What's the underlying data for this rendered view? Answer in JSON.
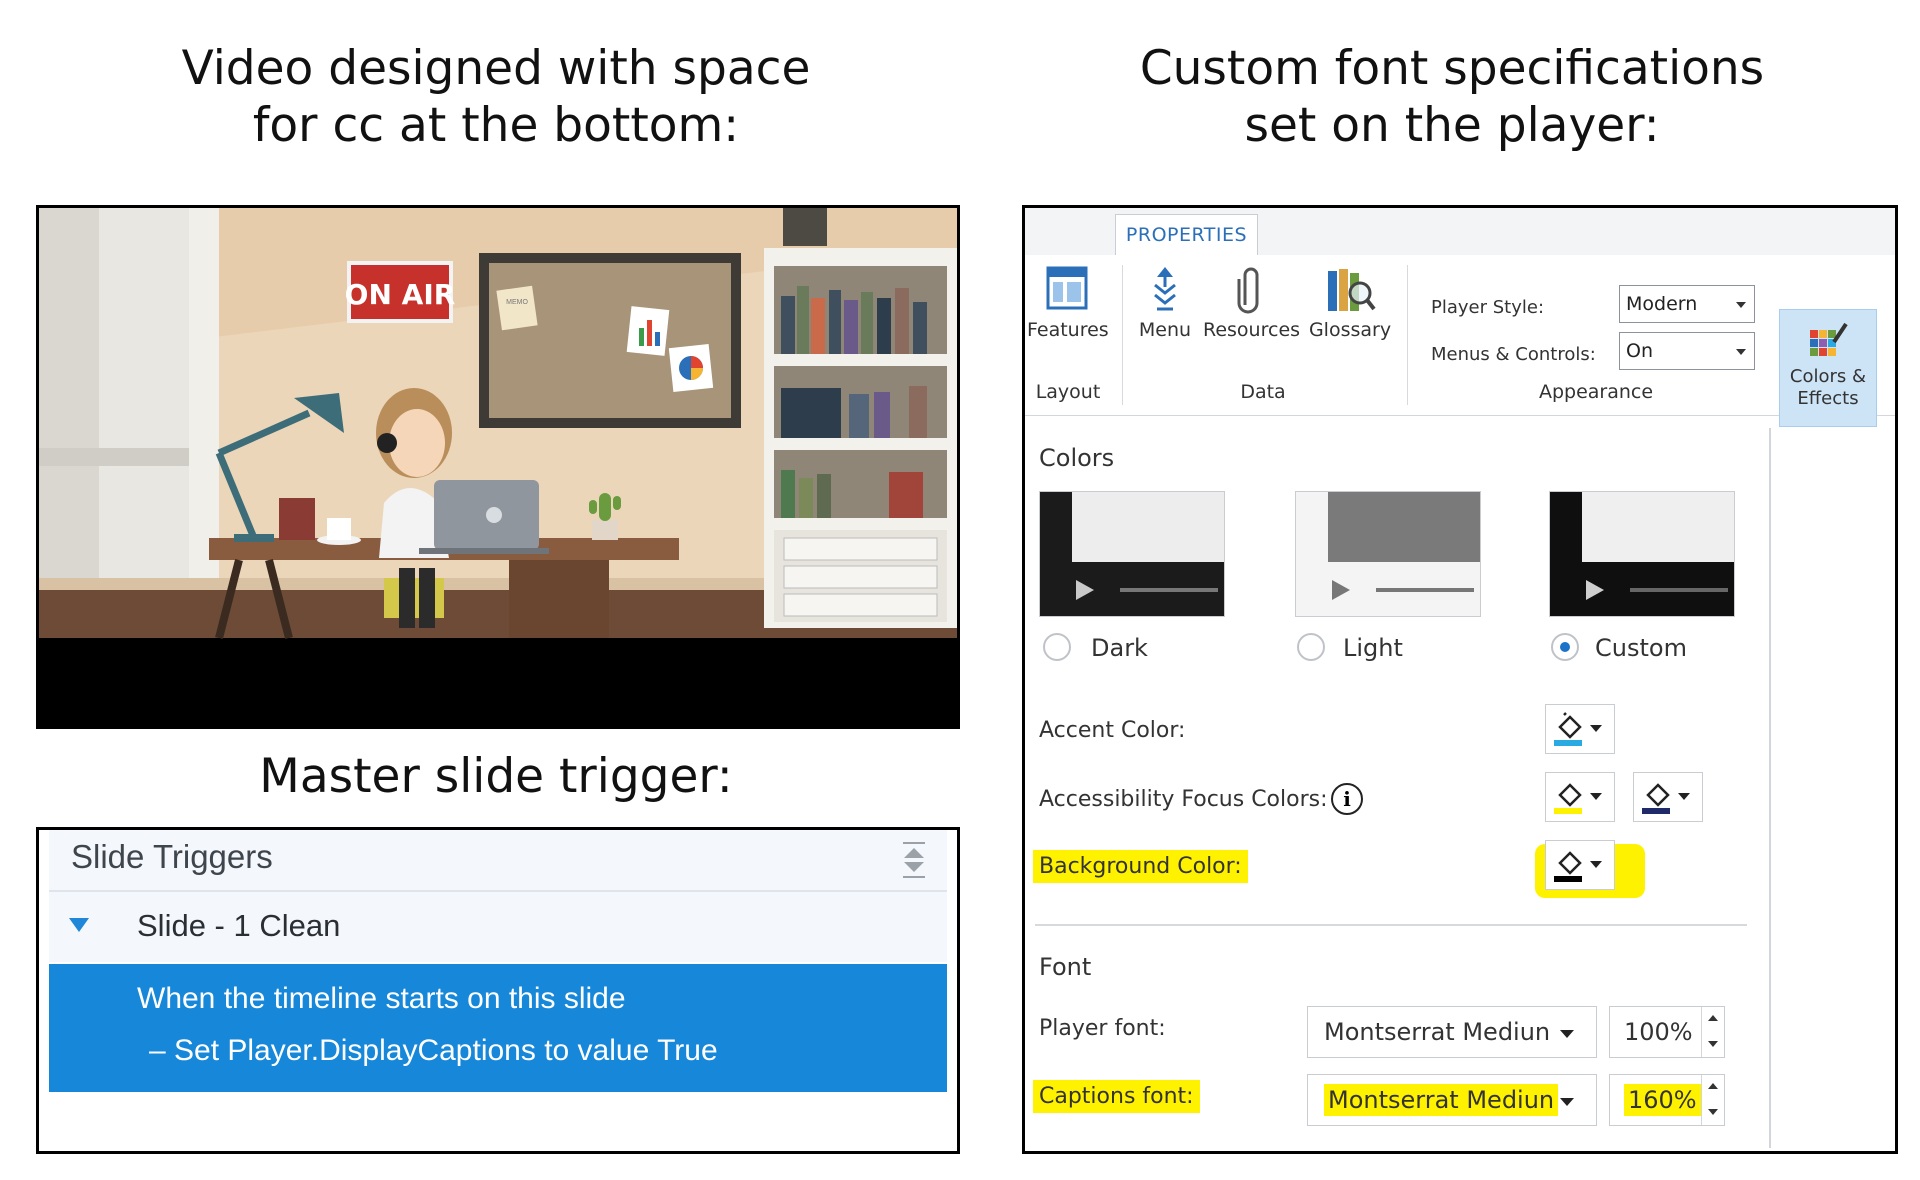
{
  "headings": {
    "video_line1": "Video designed with space",
    "video_line2": "for cc at the bottom:",
    "font_line1": "Custom font specifications",
    "font_line2": "set on the player:",
    "trigger": "Master slide trigger:"
  },
  "video": {
    "sign_text": "ON AIR",
    "note_text": "MEMO"
  },
  "slide_triggers": {
    "title": "Slide Triggers",
    "slide_name": "Slide - 1 Clean",
    "trigger_when": "When the timeline starts on this slide",
    "trigger_action": "– Set Player.DisplayCaptions to value True"
  },
  "properties": {
    "tab": "PROPERTIES",
    "ribbon": {
      "features": "Features",
      "menu": "Menu",
      "resources": "Resources",
      "glossary": "Glossary",
      "group_layout": "Layout",
      "group_data": "Data",
      "group_appearance": "Appearance",
      "player_style_label": "Player Style:",
      "player_style_value": "Modern",
      "menus_controls_label": "Menus & Controls:",
      "menus_controls_value": "On",
      "colors_effects_line1": "Colors &",
      "colors_effects_line2": "Effects"
    },
    "colors": {
      "title": "Colors",
      "themes": [
        "Dark",
        "Light",
        "Custom"
      ],
      "selected": "Custom",
      "accent_label": "Accent Color:",
      "accent_color": "#29aae1",
      "focus_label": "Accessibility Focus Colors:",
      "focus_color_1": "#fff200",
      "focus_color_2": "#1f2a6b",
      "background_label": "Background Color:",
      "background_color": "#000000"
    },
    "font": {
      "title": "Font",
      "player_font_label": "Player font:",
      "player_font_value": "Montserrat Mediun",
      "player_font_size": "100%",
      "captions_font_label": "Captions font:",
      "captions_font_value": "Montserrat Mediun",
      "captions_font_size": "160%"
    }
  }
}
